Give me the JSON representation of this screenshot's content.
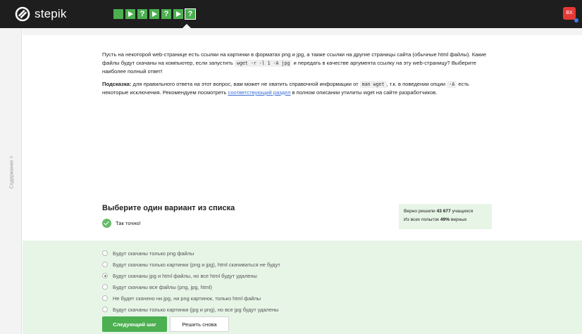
{
  "app": {
    "brand": "stepik"
  },
  "header": {
    "steps": [
      {
        "kind": "play",
        "label": ""
      },
      {
        "kind": "play",
        "label": ""
      },
      {
        "kind": "question",
        "label": "?"
      },
      {
        "kind": "play",
        "label": ""
      },
      {
        "kind": "question",
        "label": "?"
      },
      {
        "kind": "play",
        "label": ""
      },
      {
        "kind": "question",
        "label": "?"
      }
    ],
    "avatar_initials": "BX"
  },
  "sidebar": {
    "label": "Содержание >"
  },
  "lesson": {
    "p1_a": "Пусть на некоторой web-странице есть ссылки на картинки в форматах png и jpg, а также ссылки на другие страницы сайта (обычные html файлы). Какие файлы будут скачаны на компьютер, если запустить",
    "p1_code": "wget -r -l 1 -A jpg",
    "p1_b": "и передать в качестве аргумента ссылку на эту web-страницу? Выберите наиболее полный ответ!",
    "hint_label": "Подсказка:",
    "hint_a": "для правильного ответа на этот вопрос, вам может не хватить справочной информации от",
    "hint_code1": "man wget",
    "hint_b": ", т.к. в поведении опции",
    "hint_code2": "-A",
    "hint_c": "есть некоторые исключения. Рекомендуем посмотреть",
    "hint_link": "соответствующий раздел",
    "hint_d": "в полном описании утилиты wget на сайте разработчиков."
  },
  "quiz": {
    "title": "Выберите один вариант из списка",
    "status": "Так точно!",
    "stats_line1_prefix": "Верно решили",
    "stats_solved": "43 677",
    "stats_line1_suffix": "учащихся",
    "stats_line2_prefix": "Из всех попыток",
    "stats_percent": "49%",
    "stats_line2_suffix": "верных",
    "options": [
      {
        "label": "Будут скачаны только png файлы",
        "checked": false
      },
      {
        "label": "Будут скачаны только картинки (png и jpg), html скачиваться не будут",
        "checked": false
      },
      {
        "label": "Будут скачаны jpg и html файлы, но все html будут удалены",
        "checked": true
      },
      {
        "label": "Будут скачаны все файлы (png, jpg, html)",
        "checked": false
      },
      {
        "label": "Не будет скачено ни jpg, ни png картинок, только html файлы",
        "checked": false
      },
      {
        "label": "Будут скачаны только картинки (jpg и png), но все jpg будут удалены",
        "checked": false
      }
    ],
    "next_label": "Следующий шаг",
    "retry_label": "Решить снова"
  },
  "colors": {
    "accent": "#4caf50",
    "answers_bg": "#e7f5e7",
    "topbar": "#1e1e1e",
    "avatar": "#e53935",
    "link": "#3a6fd8"
  },
  "icons": {
    "logo": "stepik-logo-icon",
    "status": "check-circle-icon"
  }
}
